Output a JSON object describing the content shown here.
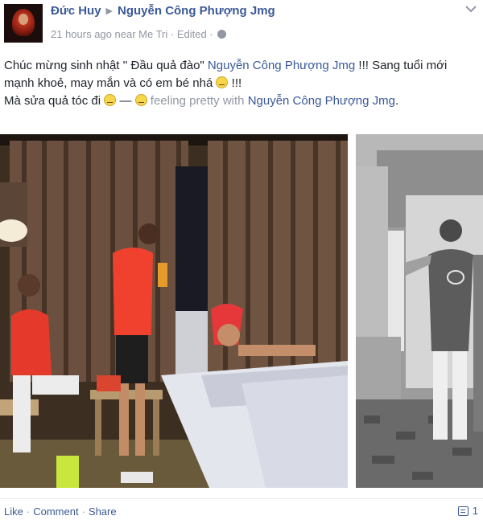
{
  "post": {
    "author": "Đức Huy",
    "target": "Nguyễn Công Phượng Jmg",
    "timestamp": "21 hours ago near Me Tri",
    "edited": "· Edited ·",
    "text": {
      "line1_a": "Chúc mừng sinh nhật '' Đầu quả đào\" ",
      "line1_link": "Nguyễn Công Phượng Jmg",
      "line1_b": " !!! Sang tuổi mới mạnh khoẻ, may mắn và có em bé nhá ",
      "line2_end": " !!!",
      "line3_a": "Mà sửa quả tóc đi ",
      "line3_dash": " — ",
      "feeling": " feeling pretty with ",
      "line3_link": "Nguyễn Công Phượng Jmg",
      "line3_end": "."
    }
  },
  "actions": {
    "like": "Like",
    "comment": "Comment",
    "share": "Share",
    "separator": "·",
    "comment_count": "1"
  },
  "icons": {
    "privacy": "globe-icon",
    "menu": "chevron-down-icon",
    "comments": "comment-icon",
    "emoji": "emoji-icon"
  }
}
